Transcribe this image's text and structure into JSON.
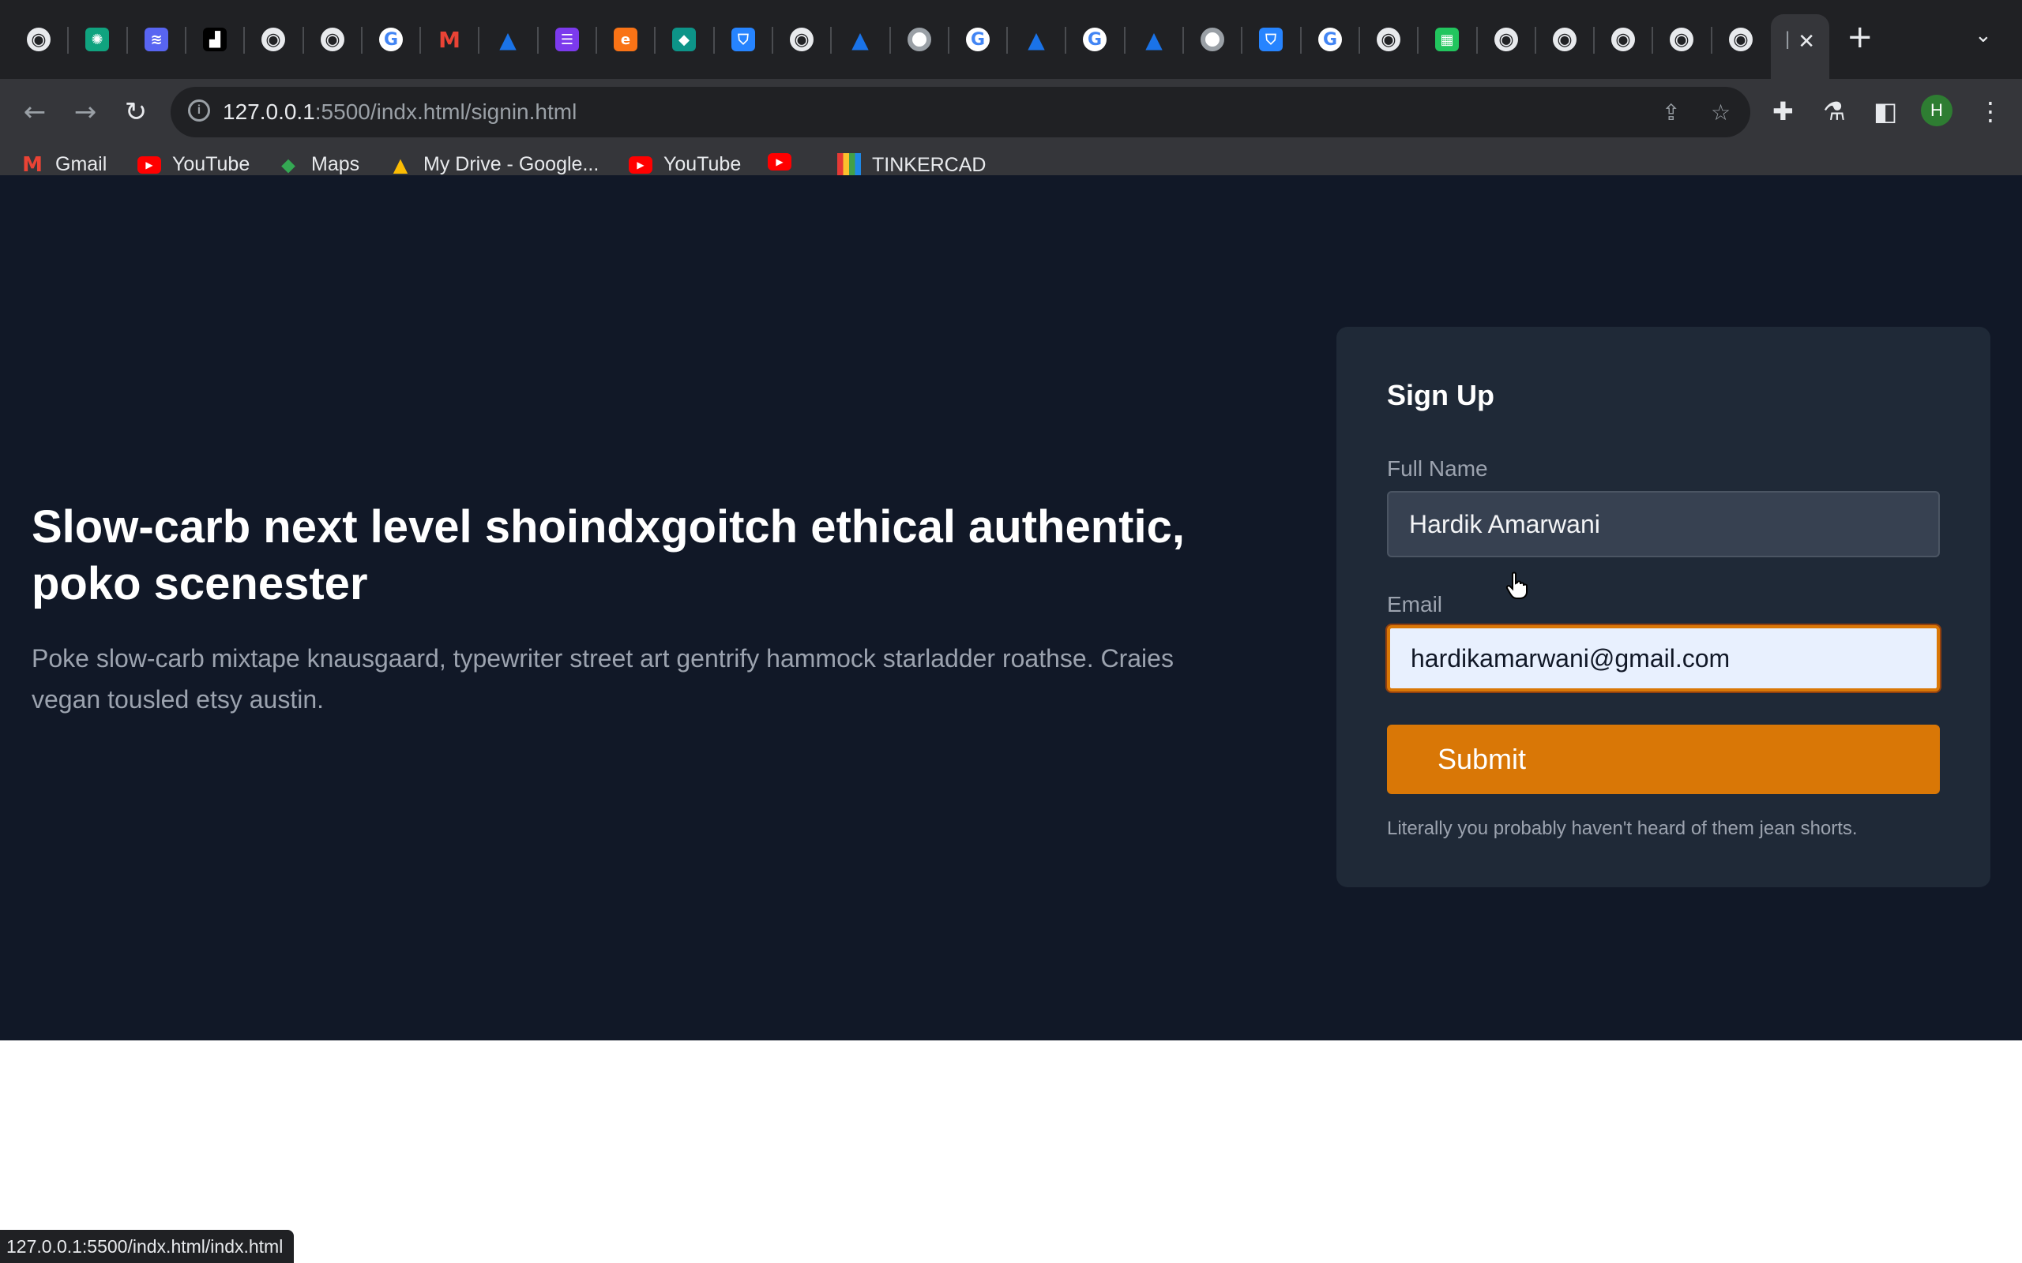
{
  "browser": {
    "tabs": [
      {
        "icon": "globe-icon",
        "glyph": "◉",
        "cls": "globe"
      },
      {
        "icon": "openai-icon",
        "glyph": "✺",
        "cls": "sq",
        "color": "#10a37f"
      },
      {
        "icon": "layers-icon",
        "glyph": "≋",
        "cls": "sq",
        "color": "#5865f2"
      },
      {
        "icon": "unsplash-icon",
        "glyph": "▟",
        "cls": "sq",
        "color": "#000000"
      },
      {
        "icon": "globe-icon",
        "glyph": "◉",
        "cls": "globe"
      },
      {
        "icon": "globe-icon",
        "glyph": "◉",
        "cls": "globe"
      },
      {
        "icon": "google-icon",
        "glyph": "G",
        "cls": "g"
      },
      {
        "icon": "gmail-icon",
        "glyph": "M",
        "cls": "m"
      },
      {
        "icon": "atlassian-icon",
        "glyph": "▲",
        "cls": "a"
      },
      {
        "icon": "list-icon",
        "glyph": "☰",
        "cls": "sq",
        "color": "#7c3aed"
      },
      {
        "icon": "eclipse-icon",
        "glyph": "e",
        "cls": "sq",
        "color": "#f97316"
      },
      {
        "icon": "diamond-icon",
        "glyph": "◆",
        "cls": "sq",
        "color": "#0d9488"
      },
      {
        "icon": "bitbucket-icon",
        "glyph": "⛉",
        "cls": "sq",
        "color": "#2684ff"
      },
      {
        "icon": "globe-icon",
        "glyph": "◉",
        "cls": "globe"
      },
      {
        "icon": "atlassian-icon",
        "glyph": "▲",
        "cls": "a"
      },
      {
        "icon": "chrome-icon",
        "glyph": "",
        "cls": "chrome"
      },
      {
        "icon": "google-icon",
        "glyph": "G",
        "cls": "g"
      },
      {
        "icon": "atlassian-icon",
        "glyph": "▲",
        "cls": "a"
      },
      {
        "icon": "google-icon",
        "glyph": "G",
        "cls": "g"
      },
      {
        "icon": "atlassian-icon",
        "glyph": "▲",
        "cls": "a"
      },
      {
        "icon": "chrome-icon",
        "glyph": "",
        "cls": "chrome"
      },
      {
        "icon": "bitbucket-icon",
        "glyph": "⛉",
        "cls": "sq",
        "color": "#2684ff"
      },
      {
        "icon": "google-icon",
        "glyph": "G",
        "cls": "g"
      },
      {
        "icon": "globe-icon",
        "glyph": "◉",
        "cls": "globe"
      },
      {
        "icon": "grid-icon",
        "glyph": "▦",
        "cls": "sq",
        "color": "#22c55e"
      },
      {
        "icon": "globe-icon",
        "glyph": "◉",
        "cls": "globe"
      },
      {
        "icon": "globe-icon",
        "glyph": "◉",
        "cls": "globe"
      },
      {
        "icon": "globe-icon",
        "glyph": "◉",
        "cls": "globe"
      },
      {
        "icon": "globe-icon",
        "glyph": "◉",
        "cls": "globe"
      },
      {
        "icon": "globe-icon",
        "glyph": "◉",
        "cls": "globe"
      }
    ],
    "active_tab_label": "|",
    "url_host": "127.0.0.1",
    "url_rest": ":5500/indx.html/signin.html",
    "profile_initial": "H",
    "bookmarks": [
      {
        "label": "Gmail",
        "icon": "gmail-icon",
        "cls": "gm",
        "glyph": "M"
      },
      {
        "label": "YouTube",
        "icon": "youtube-icon",
        "cls": "yt",
        "glyph": "▶"
      },
      {
        "label": "Maps",
        "icon": "maps-icon",
        "cls": "maps",
        "glyph": "⬥"
      },
      {
        "label": "My Drive - Google...",
        "icon": "drive-icon",
        "cls": "drive",
        "glyph": "▲"
      },
      {
        "label": "YouTube",
        "icon": "youtube-icon",
        "cls": "yt",
        "glyph": "▶"
      },
      {
        "label": "",
        "icon": "youtube-icon",
        "cls": "yt",
        "glyph": "▶"
      },
      {
        "label": "TINKERCAD",
        "icon": "tinkercad-icon",
        "cls": "tk",
        "glyph": ""
      }
    ],
    "status_url": "127.0.0.1:5500/indx.html/indx.html"
  },
  "hero": {
    "title": "Slow-carb next level shoindxgoitch ethical authentic, poko scenester",
    "text": "Poke slow-carb mixtape knausgaard, typewriter street art gentrify hammock starladder roathse. Craies vegan tousled etsy austin."
  },
  "signup": {
    "title": "Sign Up",
    "name_label": "Full Name",
    "name_value": "Hardik Amarwani",
    "email_label": "Email",
    "email_value": "hardikamarwani@gmail.com",
    "submit_label": "Submit",
    "note": "Literally you probably haven't heard of them jean shorts."
  },
  "colors": {
    "page_bg": "#111827",
    "card_bg": "#1f2937",
    "accent": "#d97706"
  }
}
